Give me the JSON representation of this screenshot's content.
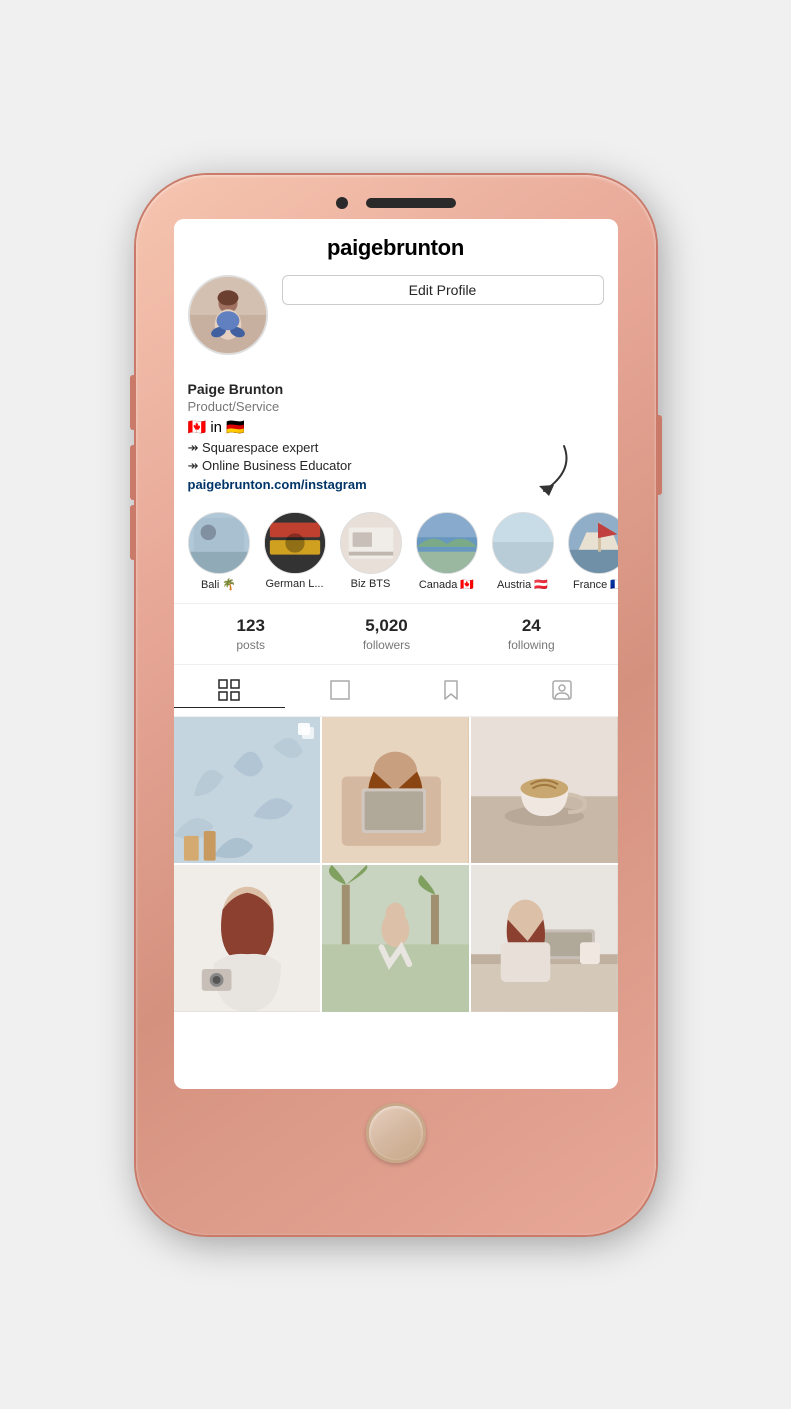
{
  "phone": {
    "background_color": "#e8a898"
  },
  "instagram": {
    "username": "paigebrunton",
    "edit_profile_label": "Edit Profile",
    "real_name": "Paige Brunton",
    "category": "Product/Service",
    "flags": "🇨🇦 in 🇩🇪",
    "bio_lines": [
      "↠ Squarespace expert",
      "↠ Online Business Educator"
    ],
    "website": "paigebrunton.com/instagram",
    "stats": {
      "posts": {
        "number": "123",
        "label": "posts"
      },
      "followers": {
        "number": "5,020",
        "label": "followers"
      },
      "following": {
        "number": "24",
        "label": "following"
      }
    },
    "highlights": [
      {
        "id": "bali",
        "label": "Bali 🌴"
      },
      {
        "id": "german",
        "label": "German L..."
      },
      {
        "id": "biz",
        "label": "Biz BTS"
      },
      {
        "id": "canada",
        "label": "Canada 🇨🇦"
      },
      {
        "id": "austria",
        "label": "Austria 🇦🇹"
      },
      {
        "id": "france",
        "label": "France 🇫🇷"
      }
    ],
    "tabs": [
      {
        "id": "grid",
        "label": "grid",
        "active": true
      },
      {
        "id": "feed",
        "label": "feed",
        "active": false
      },
      {
        "id": "saved",
        "label": "saved",
        "active": false
      },
      {
        "id": "tagged",
        "label": "tagged",
        "active": false
      }
    ]
  }
}
